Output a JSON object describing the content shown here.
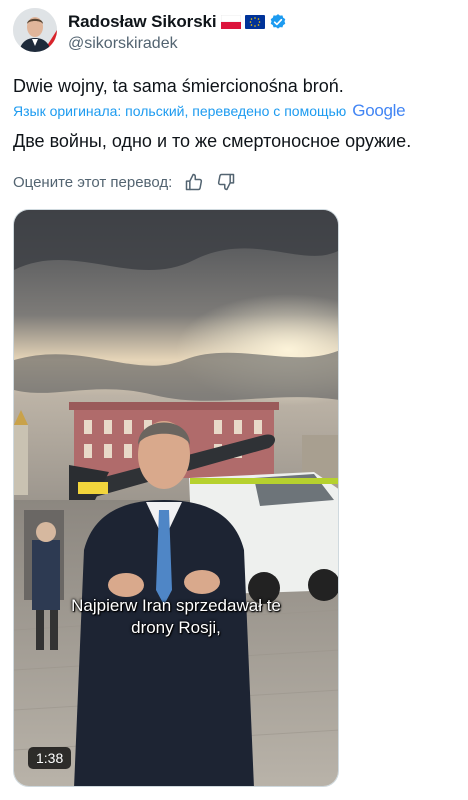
{
  "author": {
    "display_name": "Radosław Sikorski",
    "handle": "@sikorskiradek",
    "badges": [
      "poland-flag-icon",
      "eu-flag-icon",
      "verified-icon"
    ],
    "verified_color": "#1d9bf0"
  },
  "tweet": {
    "text": "Dwie wojny, ta sama śmiercionośna broń.",
    "translation_note": "Язык оригинала: польский, переведено с помощью",
    "translation_provider": "Google",
    "translated_text": "Две войны, одно и то же смертоносное оружие.",
    "rate_label": "Оцените этот перевод:"
  },
  "video": {
    "subtitle_line1": "Najpierw Iran sprzedawał te",
    "subtitle_line2": "drony Rosji,",
    "duration": "1:38"
  },
  "colors": {
    "link_blue": "#1d9bf0",
    "secondary_text": "#536471"
  }
}
